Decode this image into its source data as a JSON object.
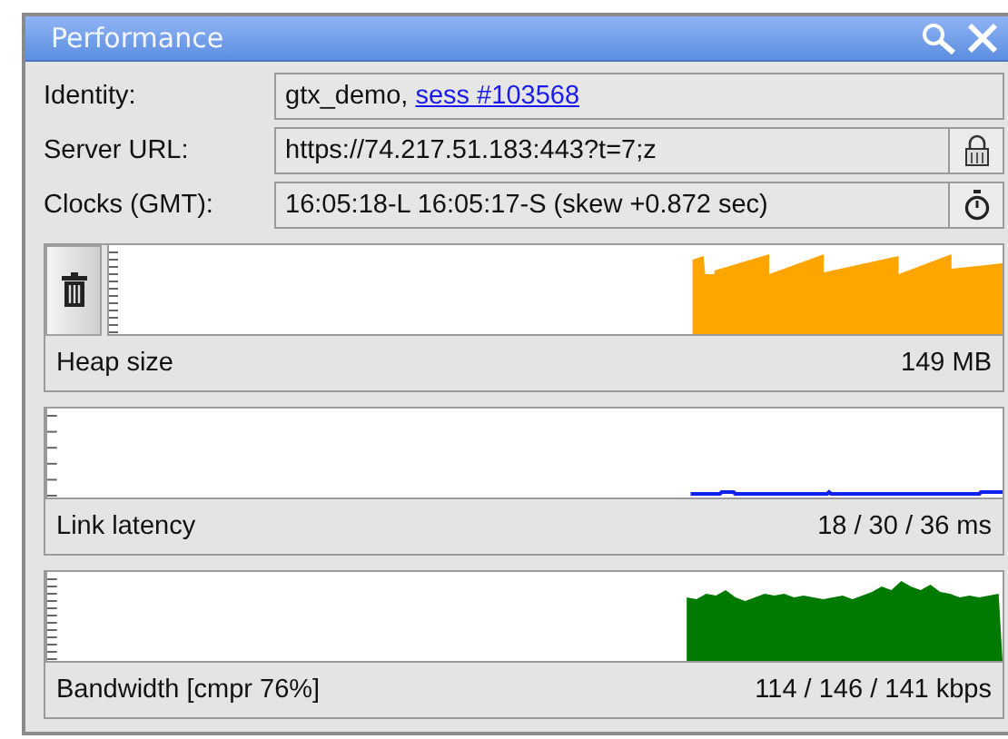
{
  "window": {
    "title": "Performance"
  },
  "fields": [
    {
      "label": "Identity:",
      "value": "gtx_demo,",
      "link": "sess #103568",
      "kind": "plain"
    },
    {
      "label": "Server URL:",
      "value": "https://74.217.51.183:443?t=7;z",
      "kind": "lock"
    },
    {
      "label": "Clocks (GMT):",
      "value": "16:05:18-L 16:05:17-S (skew +0.872 sec)",
      "kind": "stopwatch"
    }
  ],
  "monitors": [
    {
      "kind": "heap",
      "label": "Heap size",
      "reading": "149 MB"
    },
    {
      "kind": "latency",
      "label": "Link latency",
      "reading": "18 / 30 / 36 ms"
    },
    {
      "kind": "bandwidth",
      "label": "Bandwidth [cmpr 76%]",
      "reading": "114 / 146 / 141 kbps"
    }
  ]
}
